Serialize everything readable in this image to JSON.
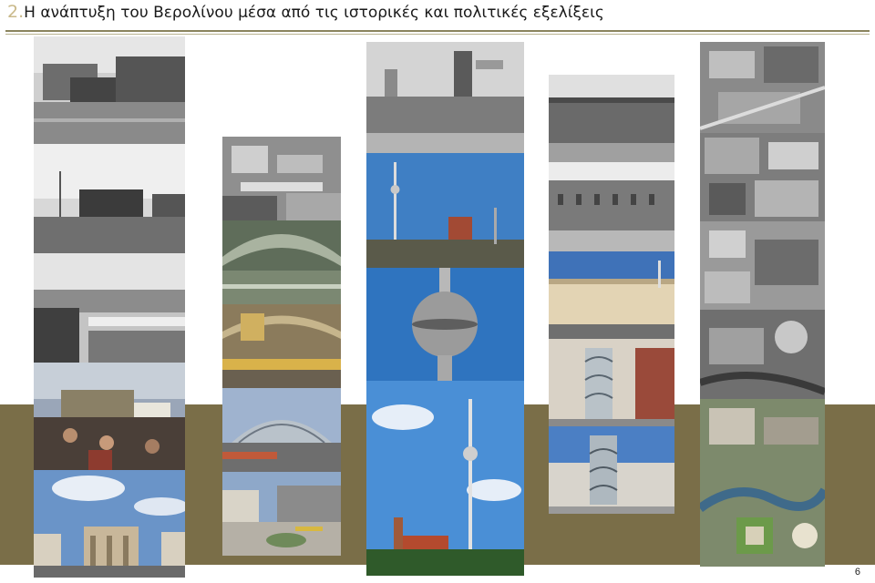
{
  "slide": {
    "title_number": "2.",
    "title_text": "Η ανάπτυξη του Βερολίνου μέσα από τις ιστορικές και πολιτικές εξελίξεις",
    "page_number": "6"
  },
  "colors": {
    "band": "#7a6e48",
    "rule": "#8a845e",
    "title_number": "#c9b98a"
  }
}
